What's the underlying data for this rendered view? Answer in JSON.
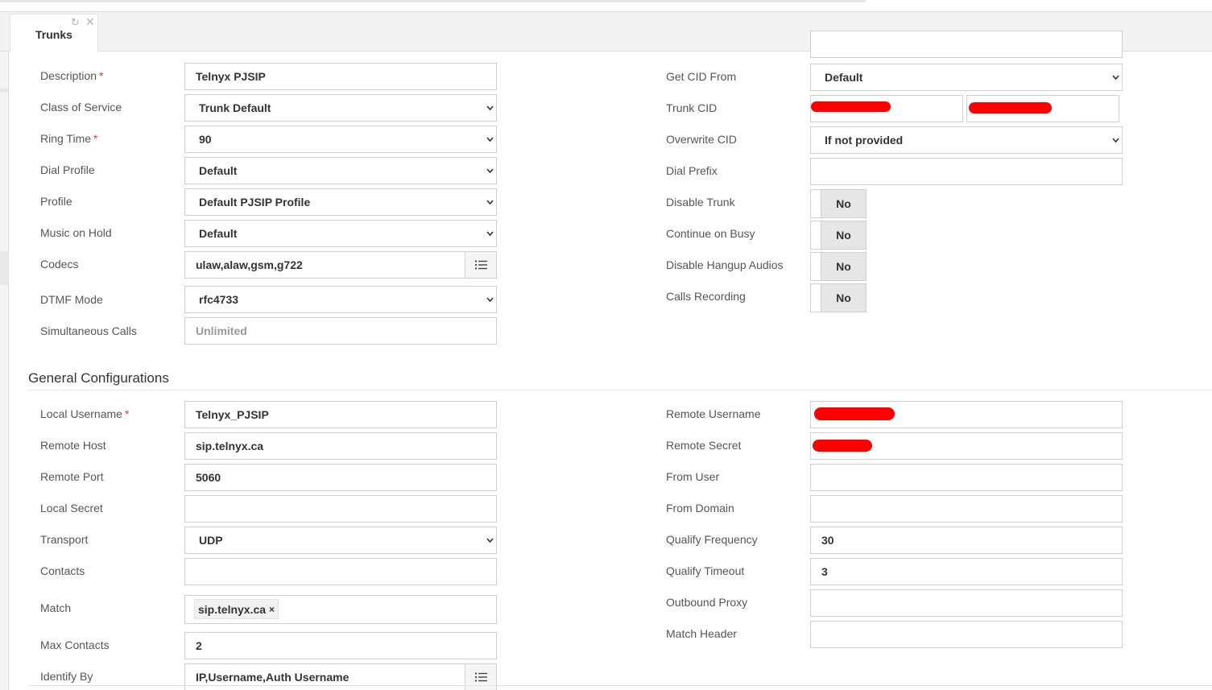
{
  "tab": {
    "label": "Trunks",
    "refresh_icon": "refresh-icon",
    "close_icon": "close-icon"
  },
  "left": {
    "description": {
      "label": "Description",
      "value": "Telnyx PJSIP"
    },
    "class_of_service": {
      "label": "Class of Service",
      "value": "Trunk Default"
    },
    "ring_time": {
      "label": "Ring Time",
      "value": "90"
    },
    "dial_profile": {
      "label": "Dial Profile",
      "value": "Default"
    },
    "profile": {
      "label": "Profile",
      "value": "Default PJSIP Profile"
    },
    "music_on_hold": {
      "label": "Music on Hold",
      "value": "Default"
    },
    "codecs": {
      "label": "Codecs",
      "value": "ulaw,alaw,gsm,g722"
    },
    "dtmf_mode": {
      "label": "DTMF Mode",
      "value": "rfc4733"
    },
    "simultaneous_calls": {
      "label": "Simultaneous Calls",
      "placeholder": "Unlimited"
    }
  },
  "right": {
    "get_cid_from": {
      "label": "Get CID From",
      "value": "Default"
    },
    "trunk_cid": {
      "label": "Trunk CID"
    },
    "overwrite_cid": {
      "label": "Overwrite CID",
      "value": "If not provided"
    },
    "dial_prefix": {
      "label": "Dial Prefix",
      "value": ""
    },
    "disable_trunk": {
      "label": "Disable Trunk",
      "value": "No"
    },
    "continue_on_busy": {
      "label": "Continue on Busy",
      "value": "No"
    },
    "disable_hangup_audios": {
      "label": "Disable Hangup Audios",
      "value": "No"
    },
    "calls_recording": {
      "label": "Calls Recording",
      "value": "No"
    }
  },
  "general": {
    "title": "General Configurations",
    "local_username": {
      "label": "Local Username",
      "value": "Telnyx_PJSIP"
    },
    "remote_host": {
      "label": "Remote Host",
      "value": "sip.telnyx.ca"
    },
    "remote_port": {
      "label": "Remote Port",
      "value": "5060"
    },
    "local_secret": {
      "label": "Local Secret",
      "value": ""
    },
    "transport": {
      "label": "Transport",
      "value": "UDP"
    },
    "contacts": {
      "label": "Contacts",
      "value": ""
    },
    "match": {
      "label": "Match",
      "tag": "sip.telnyx.ca",
      "tag_remove": "×"
    },
    "max_contacts": {
      "label": "Max Contacts",
      "value": "2"
    },
    "identify_by": {
      "label": "Identify By",
      "value": "IP,Username,Auth Username"
    },
    "remote_username": {
      "label": "Remote Username"
    },
    "remote_secret": {
      "label": "Remote Secret"
    },
    "from_user": {
      "label": "From User",
      "value": ""
    },
    "from_domain": {
      "label": "From Domain",
      "value": ""
    },
    "qualify_frequency": {
      "label": "Qualify Frequency",
      "value": "30"
    },
    "qualify_timeout": {
      "label": "Qualify Timeout",
      "value": "3"
    },
    "outbound_proxy": {
      "label": "Outbound Proxy",
      "value": ""
    },
    "match_header": {
      "label": "Match Header",
      "value": ""
    }
  },
  "required_marker": "*",
  "colors": {
    "redaction": "#ff0000",
    "required": "#e53935",
    "toggle_bg": "#e6e6e6"
  },
  "icons": {
    "select_caret": "chevron-down-icon",
    "list_picker": "list-icon"
  }
}
